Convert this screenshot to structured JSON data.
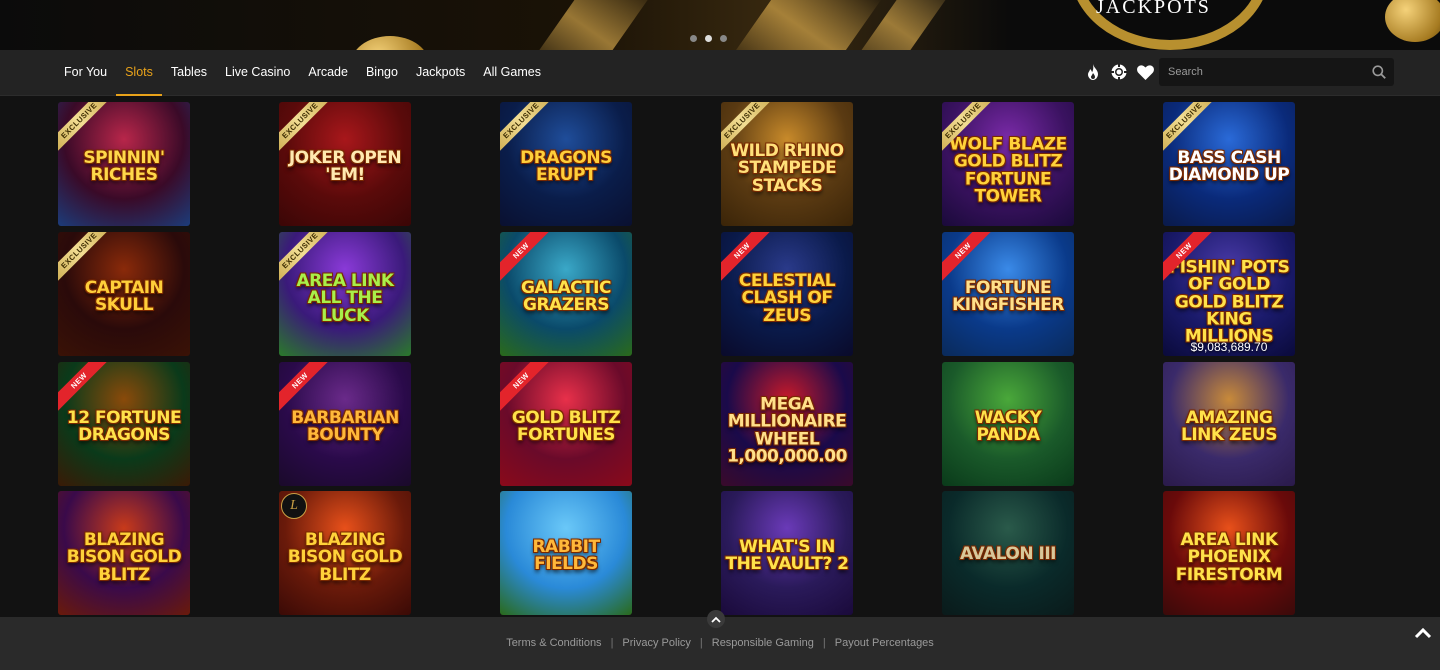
{
  "banner": {
    "text": "JACKPOTS",
    "slides": 3,
    "active_slide": 2
  },
  "nav": {
    "tabs": [
      {
        "label": "For You",
        "active": false
      },
      {
        "label": "Slots",
        "active": true
      },
      {
        "label": "Tables",
        "active": false
      },
      {
        "label": "Live Casino",
        "active": false
      },
      {
        "label": "Arcade",
        "active": false
      },
      {
        "label": "Bingo",
        "active": false
      },
      {
        "label": "Jackpots",
        "active": false
      },
      {
        "label": "All Games",
        "active": false
      }
    ],
    "icons": [
      "flame-icon",
      "poker-chip-icon",
      "heart-icon"
    ],
    "search": {
      "placeholder": "Search",
      "value": ""
    }
  },
  "games": [
    {
      "title": "Spinnin' Riches",
      "ribbon": "EXCLUSIVE",
      "bg": [
        "#3a0a28",
        "#b8264a",
        "#1c3c7a"
      ],
      "color": "#ffd84a"
    },
    {
      "title": "Joker Open 'Em!",
      "ribbon": "EXCLUSIVE",
      "bg": [
        "#5a0a0a",
        "#a8171b",
        "#3a0606"
      ],
      "color": "#ffe9b0"
    },
    {
      "title": "Dragons Erupt",
      "ribbon": "EXCLUSIVE",
      "bg": [
        "#0a1d4a",
        "#1f4d9a",
        "#0a1030"
      ],
      "color": "#ffcf3a"
    },
    {
      "title": "Wild Rhino Stampede Stacks",
      "ribbon": "EXCLUSIVE",
      "bg": [
        "#5a3a12",
        "#c88a2a",
        "#3a2408"
      ],
      "color": "#ffe07a"
    },
    {
      "title": "Wolf Blaze Gold Blitz Fortune Tower",
      "ribbon": "EXCLUSIVE",
      "bg": [
        "#3a1260",
        "#7a2aa8",
        "#1a0a3a"
      ],
      "color": "#ffd23a"
    },
    {
      "title": "Bass Cash Diamond Up",
      "ribbon": "EXCLUSIVE",
      "bg": [
        "#0a2a7a",
        "#2a6ad8",
        "#0a1a4a"
      ],
      "color": "#ffffff"
    },
    {
      "title": "Captain Skull",
      "ribbon": "EXCLUSIVE",
      "bg": [
        "#2a0a0a",
        "#8a2a0a",
        "#3a1206"
      ],
      "color": "#ffcf3a"
    },
    {
      "title": "Area Link All The Luck",
      "ribbon": "EXCLUSIVE",
      "bg": [
        "#3a1a7a",
        "#8a3ad8",
        "#2a7a2a"
      ],
      "color": "#a8f04a"
    },
    {
      "title": "Galactic Grazers",
      "ribbon": "NEW",
      "bg": [
        "#0a4a6a",
        "#3aa8c8",
        "#2a6a1a"
      ],
      "color": "#ffe24a"
    },
    {
      "title": "Celestial Clash of Zeus",
      "ribbon": "NEW",
      "bg": [
        "#0a1a4a",
        "#2a3a8a",
        "#0a0a2a"
      ],
      "color": "#ffd23a"
    },
    {
      "title": "Fortune Kingfisher",
      "ribbon": "NEW",
      "bg": [
        "#0a3a8a",
        "#3a8ae8",
        "#0a2a5a"
      ],
      "color": "#ffe08a"
    },
    {
      "title": "Fishin' Pots of Gold Gold Blitz King Millions",
      "ribbon": "NEW",
      "bg": [
        "#1a1a6a",
        "#4a3aa8",
        "#0a0a3a"
      ],
      "color": "#ffe24a",
      "amount": "$9,083,689.70"
    },
    {
      "title": "12 Fortune Dragons",
      "ribbon": "NEW",
      "bg": [
        "#0a3a1a",
        "#8a4a0a",
        "#3a1a06"
      ],
      "color": "#ffe24a"
    },
    {
      "title": "Barbarian Bounty",
      "ribbon": "NEW",
      "bg": [
        "#2a0a4a",
        "#6a2a8a",
        "#1a0a2a"
      ],
      "color": "#ffb83a"
    },
    {
      "title": "Gold Blitz Fortunes",
      "ribbon": "NEW",
      "bg": [
        "#6a0a2a",
        "#e8304a",
        "#8a0a1a"
      ],
      "color": "#ffe24a"
    },
    {
      "title": "Mega Millionaire Wheel 1,000,000.00",
      "ribbon": "",
      "bg": [
        "#1a0a4a",
        "#c81a2a",
        "#3a0a2a"
      ],
      "color": "#ffe08a"
    },
    {
      "title": "Wacky Panda",
      "ribbon": "",
      "bg": [
        "#1a5a2a",
        "#4aa83a",
        "#0a3a1a"
      ],
      "color": "#ffe24a"
    },
    {
      "title": "Amazing Link Zeus",
      "ribbon": "",
      "bg": [
        "#3a2a6a",
        "#c88a3a",
        "#2a1a4a"
      ],
      "color": "#ffe24a"
    },
    {
      "title": "Blazing Bison Gold Blitz",
      "ribbon": "",
      "bg": [
        "#3a0a4a",
        "#c83a1a",
        "#6a1a0a"
      ],
      "color": "#ffd23a"
    },
    {
      "title": "Blazing Bison Gold Blitz",
      "ribbon": "",
      "bg": [
        "#6a1a0a",
        "#e8501a",
        "#3a0a06"
      ],
      "color": "#ffd23a",
      "badge": "L"
    },
    {
      "title": "Rabbit Fields",
      "ribbon": "",
      "bg": [
        "#2a8ad8",
        "#6ac8f8",
        "#2a6a1a"
      ],
      "color": "#ffb83a"
    },
    {
      "title": "What's in the Vault? 2",
      "ribbon": "",
      "bg": [
        "#2a1a5a",
        "#6a3ab8",
        "#1a0a3a"
      ],
      "color": "#ffe24a"
    },
    {
      "title": "Avalon III",
      "ribbon": "",
      "bg": [
        "#0a2a2a",
        "#2a5a4a",
        "#0a1a1a"
      ],
      "color": "#d8c89a"
    },
    {
      "title": "Area Link Phoenix Firestorm",
      "ribbon": "",
      "bg": [
        "#6a0a0a",
        "#e8501a",
        "#3a0a0a"
      ],
      "color": "#ffe24a"
    }
  ],
  "footer": {
    "links": [
      "Terms & Conditions",
      "Privacy Policy",
      "Responsible Gaming",
      "Payout Percentages"
    ]
  }
}
